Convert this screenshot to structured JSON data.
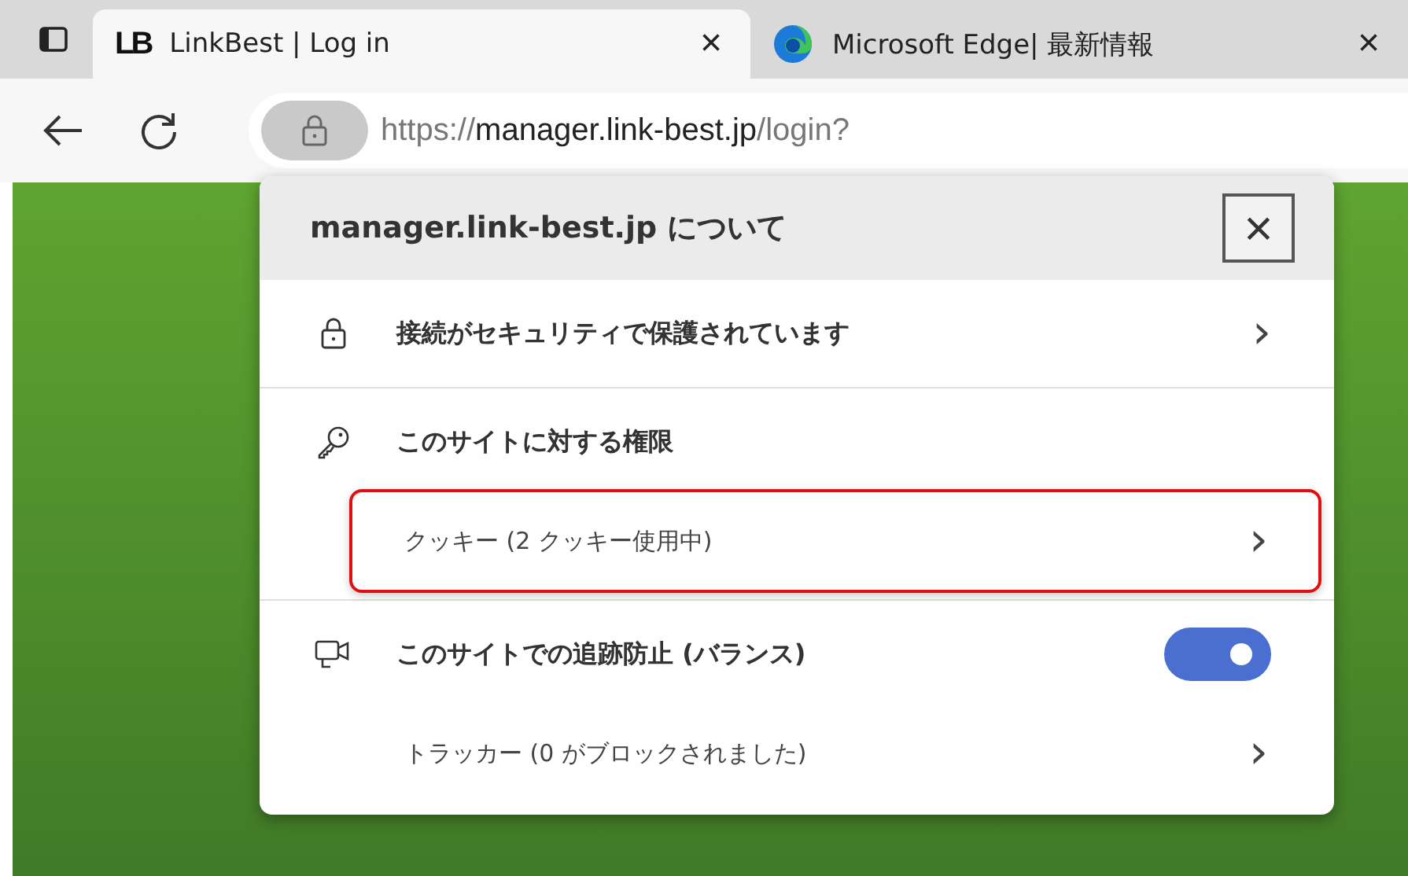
{
  "tabs": [
    {
      "logo_text": "LB",
      "title": "LinkBest | Log in",
      "selected": true,
      "close": "×"
    },
    {
      "title": "Microsoft Edge| 最新情報",
      "selected": false,
      "close": "×"
    }
  ],
  "address": {
    "scheme": "https://",
    "host": "manager.link-best.jp",
    "path": "/login?"
  },
  "popup": {
    "title": "manager.link-best.jp について",
    "close": "×",
    "sections": [
      {
        "items": [
          {
            "kind": "link",
            "label": "接続がセキュリティで保護されています",
            "chevron": "›"
          }
        ]
      },
      {
        "items": [
          {
            "kind": "header",
            "label": "このサイトに対する権限"
          },
          {
            "kind": "sub",
            "label": "クッキー (2 クッキー使用中)",
            "chevron": "›",
            "highlighted": true
          }
        ]
      },
      {
        "items": [
          {
            "kind": "toggle",
            "label": "このサイトでの追跡防止 (バランス)",
            "on": true
          },
          {
            "kind": "sub",
            "label": "トラッカー (0 がブロックされました)",
            "chevron": "›",
            "highlighted": false
          }
        ]
      }
    ]
  }
}
